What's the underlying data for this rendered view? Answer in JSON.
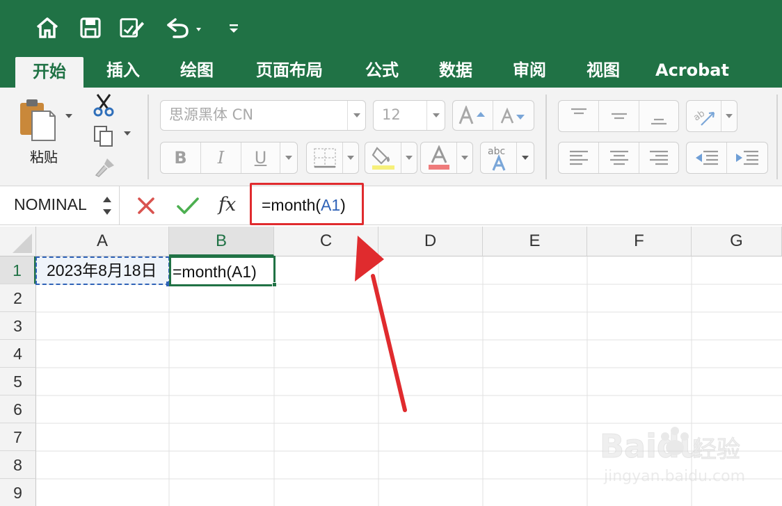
{
  "quick_access": {
    "icons": [
      "home-icon",
      "save-icon",
      "edit-document-icon",
      "undo-icon",
      "customize-toolbar-icon"
    ]
  },
  "ribbon_tabs": [
    {
      "label": "开始",
      "active": true
    },
    {
      "label": "插入",
      "active": false
    },
    {
      "label": "绘图",
      "active": false
    },
    {
      "label": "页面布局",
      "active": false
    },
    {
      "label": "公式",
      "active": false
    },
    {
      "label": "数据",
      "active": false
    },
    {
      "label": "审阅",
      "active": false
    },
    {
      "label": "视图",
      "active": false
    },
    {
      "label": "Acrobat",
      "active": false
    }
  ],
  "clipboard": {
    "paste_label": "粘贴"
  },
  "font": {
    "family": "思源黑体 CN",
    "size": "12"
  },
  "formula_bar": {
    "name_box": "NOMINAL",
    "fx_label": "fx",
    "formula_prefix": "=month(",
    "formula_ref": "A1",
    "formula_suffix": ")"
  },
  "sheet": {
    "columns": [
      "A",
      "B",
      "C",
      "D",
      "E",
      "F",
      "G"
    ],
    "rows": [
      "1",
      "2",
      "3",
      "4",
      "5",
      "6",
      "7",
      "8",
      "9"
    ],
    "selected_column": "B",
    "selected_row": "1",
    "cells": {
      "A1": "2023年8月18日",
      "B1": "=month(A1)"
    }
  },
  "colors": {
    "excel_green": "#207245",
    "highlight_red": "#e02b2e",
    "reference_blue": "#2f63b8"
  },
  "watermark": {
    "brand": "Baidu",
    "brand_cn": "经验",
    "url": "jingyan.baidu.com"
  }
}
